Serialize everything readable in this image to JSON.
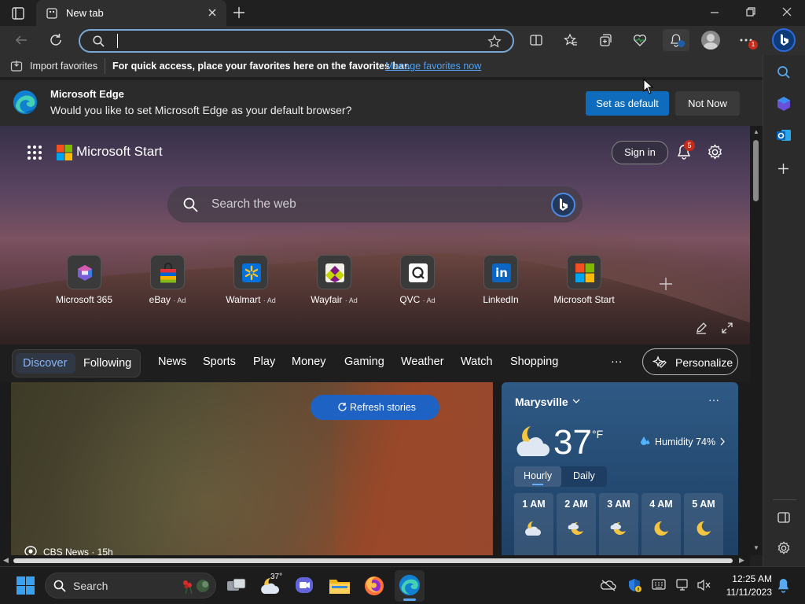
{
  "browser": {
    "tab_title": "New tab",
    "address_value": "",
    "favorites_bar": {
      "import_label": "Import favorites",
      "message": "For quick access, place your favorites here on the favorites bar.",
      "manage_link": "Manage favorites now"
    },
    "notification_badge": "1"
  },
  "banner": {
    "title": "Microsoft Edge",
    "message": "Would you like to set Microsoft Edge as your default browser?",
    "set_default_label": "Set as default",
    "not_now_label": "Not Now"
  },
  "start": {
    "brand": "Microsoft Start",
    "sign_in_label": "Sign in",
    "notification_count": "5",
    "search_placeholder": "Search the web",
    "quick_links": [
      {
        "label": "Microsoft 365",
        "ad": ""
      },
      {
        "label": "eBay",
        "ad": "Ad"
      },
      {
        "label": "Walmart",
        "ad": "Ad"
      },
      {
        "label": "Wayfair",
        "ad": "Ad"
      },
      {
        "label": "QVC",
        "ad": "Ad"
      },
      {
        "label": "LinkedIn",
        "ad": ""
      },
      {
        "label": "Microsoft Start",
        "ad": ""
      }
    ],
    "feed_tabs": [
      "Discover",
      "Following"
    ],
    "nav_items": [
      "News",
      "Sports",
      "Play",
      "Money",
      "Gaming",
      "Weather",
      "Watch",
      "Shopping"
    ],
    "more_label": "···",
    "personalize_label": "Personalize",
    "refresh_label": "Refresh stories",
    "story_source": "CBS News · 15h"
  },
  "weather": {
    "location": "Marysville",
    "temperature": "37",
    "unit": "°F",
    "humidity": "Humidity 74%",
    "toggle": [
      "Hourly",
      "Daily"
    ],
    "hours": [
      "1 AM",
      "2 AM",
      "3 AM",
      "4 AM",
      "5 AM"
    ]
  },
  "taskbar": {
    "search_label": "Search",
    "weather_temp": "37°",
    "time": "12:25 AM",
    "date": "11/11/2023"
  },
  "colors": {
    "accent_blue": "#0f6cbd",
    "link": "#4ea1f3",
    "badge_red": "#c42b1c"
  }
}
